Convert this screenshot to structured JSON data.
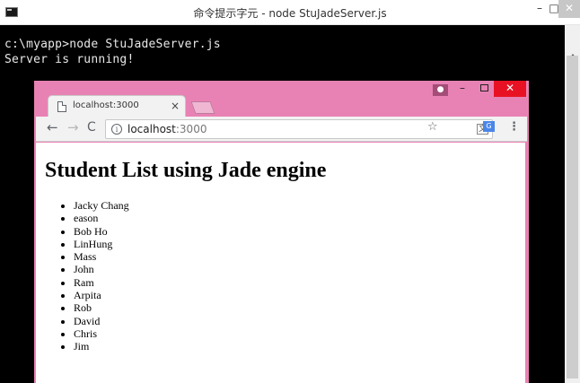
{
  "console": {
    "title": "命令提示字元 - node  StuJadeServer.js",
    "lines": [
      "c:\\myapp>node StuJadeServer.js",
      "Server is running!"
    ],
    "window_buttons": {
      "minimize": "–",
      "maximize": "□",
      "close": "✕"
    }
  },
  "browser": {
    "tab_title": "localhost:3000",
    "tab_close": "×",
    "url_host": "localhost",
    "url_port": ":3000",
    "window_buttons": {
      "minimize": "–",
      "close": "✕"
    },
    "nav": {
      "back": "←",
      "forward": "→",
      "reload": "C",
      "menu": "⋮",
      "star": "☆",
      "info": "i"
    },
    "accent_color": "#e882b4"
  },
  "page": {
    "heading": "Student List using Jade engine",
    "students": [
      "Jacky Chang",
      "eason",
      "Bob Ho",
      "LinHung",
      "Mass",
      "John",
      "Ram",
      "Arpita",
      "Rob",
      "David",
      "Chris",
      "Jim"
    ]
  }
}
